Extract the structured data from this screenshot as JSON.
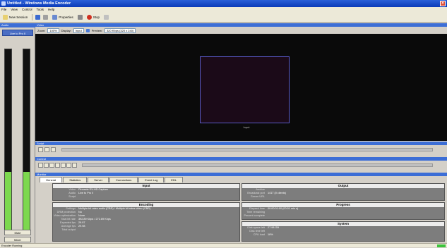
{
  "window": {
    "title": "Untitled - Windows Media Encoder"
  },
  "menu": [
    "File",
    "View",
    "Control",
    "Tools",
    "Help"
  ],
  "toolbar": {
    "new_session": "New Session",
    "properties": "Properties",
    "stop": "Stop"
  },
  "left": {
    "header": "Audio",
    "source": "Live to Pro II",
    "meter_left_level": 0.33,
    "meter_right_level": 0.33,
    "mute_label": "Mute",
    "mixer_label": "Mixer"
  },
  "video": {
    "header": "Video",
    "zoom_label": "Zoom:",
    "zoom_value": "100%",
    "display_label": "Display:",
    "display_value": "Input",
    "preview_label": "Preview:",
    "preview_value": "320 Kbps (320 x 240)",
    "caption": "Input"
  },
  "script": {
    "header": "Script"
  },
  "control": {
    "header": "Control"
  },
  "monitor": {
    "header": "Monitor",
    "tabs": [
      "General",
      "Statistics",
      "Server",
      "Connections",
      "Event Log",
      "EDL"
    ],
    "active_tab": "General",
    "input": {
      "title": "Input",
      "rows": [
        {
          "k": "Video",
          "v": "Pinnacle DV-HD Capture"
        },
        {
          "k": "Audio",
          "v": "Live to Pro II"
        },
        {
          "k": "Script",
          "v": ""
        }
      ]
    },
    "output": {
      "title": "Output",
      "rows": [
        {
          "k": "Archive",
          "v": ""
        },
        {
          "k": "Broadcast port",
          "v": "1417 (0 clients)"
        },
        {
          "k": "Server URL",
          "v": ""
        }
      ]
    },
    "encoding": {
      "title": "Encoding",
      "rows": [
        {
          "k": "Settings",
          "v": "Multiple bit rates audio (CBR) / Multiple bit rates video (CBR)"
        },
        {
          "k": "DRM protection",
          "v": "No"
        },
        {
          "k": "Video optimization",
          "v": "None"
        },
        {
          "k": "Total bit rate",
          "v": "392.89 Kbps / 272.69 Kbps"
        },
        {
          "k": "Expected fps",
          "v": "29.97"
        },
        {
          "k": "Average fps",
          "v": "29.98"
        },
        {
          "k": "Total output",
          "v": ""
        }
      ]
    },
    "progress": {
      "title": "Progress",
      "rows": [
        {
          "k": "Elapsed time",
          "v": "00:00:01:00 (00:01 min s)"
        },
        {
          "k": "Time remaining",
          "v": ""
        },
        {
          "k": "Percent complete",
          "v": ""
        }
      ]
    },
    "system": {
      "title": "System",
      "rows": [
        {
          "k": "Disk space left",
          "v": "27.98 GB"
        },
        {
          "k": "Disk time left",
          "v": ""
        },
        {
          "k": "CPU load",
          "v": "18%"
        }
      ]
    }
  },
  "status": {
    "text": "Encoder Running"
  }
}
